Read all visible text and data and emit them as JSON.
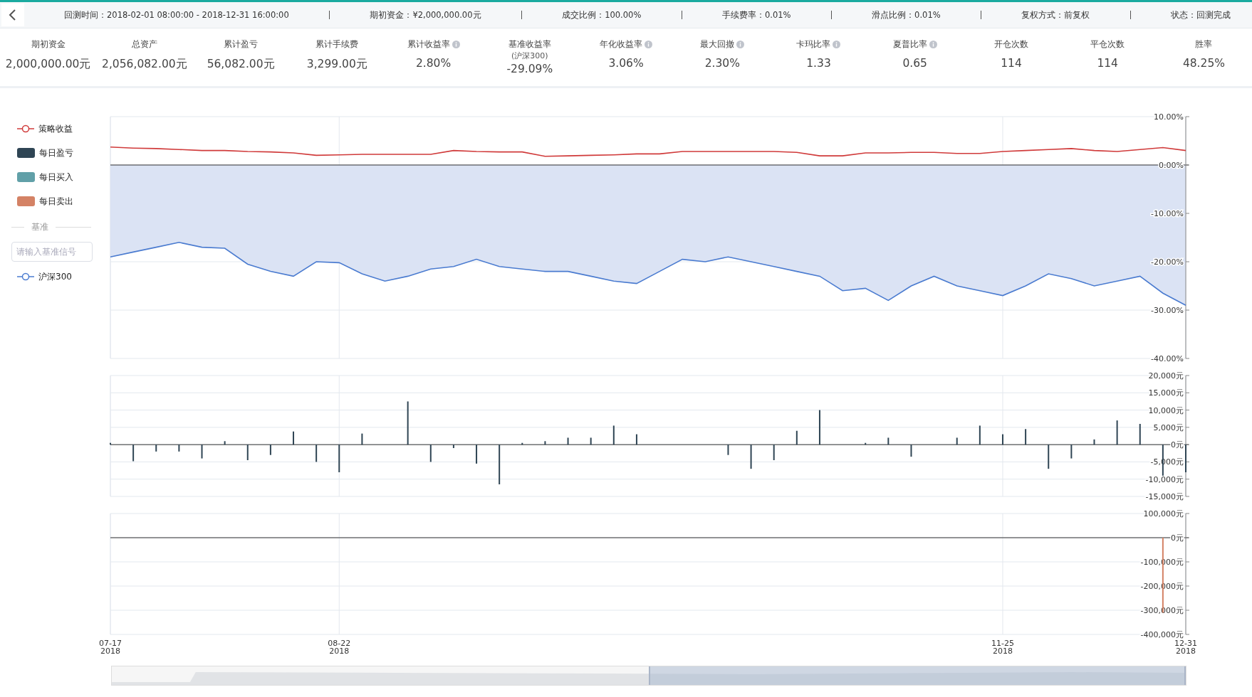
{
  "header": {
    "items": [
      {
        "label": "回测时间：2018-02-01 08:00:00 - 2018-12-31 16:00:00"
      },
      {
        "label": "期初资金：¥2,000,000.00元"
      },
      {
        "label": "成交比例：100.00%"
      },
      {
        "label": "手续费率：0.01%"
      },
      {
        "label": "滑点比例：0.01%"
      },
      {
        "label": "复权方式：前复权"
      },
      {
        "label": "状态：回测完成"
      }
    ]
  },
  "stats": [
    {
      "label": "期初资金",
      "value": "2,000,000.00元",
      "info": false
    },
    {
      "label": "总资产",
      "value": "2,056,082.00元",
      "info": false
    },
    {
      "label": "累计盈亏",
      "value": "56,082.00元",
      "info": false
    },
    {
      "label": "累计手续费",
      "value": "3,299.00元",
      "info": false
    },
    {
      "label": "累计收益率",
      "value": "2.80%",
      "info": true
    },
    {
      "label": "基准收益率",
      "sub": "(沪深300)",
      "value": "-29.09%",
      "info": false
    },
    {
      "label": "年化收益率",
      "value": "3.06%",
      "info": true
    },
    {
      "label": "最大回撤",
      "value": "2.30%",
      "info": true
    },
    {
      "label": "卡玛比率",
      "value": "1.33",
      "info": true
    },
    {
      "label": "夏普比率",
      "value": "0.65",
      "info": true
    },
    {
      "label": "开仓次数",
      "value": "114",
      "info": false
    },
    {
      "label": "平仓次数",
      "value": "114",
      "info": false
    },
    {
      "label": "胜率",
      "value": "48.25%",
      "info": false
    }
  ],
  "legend": [
    {
      "kind": "line",
      "label": "策略收益",
      "color": "#d03a3a"
    },
    {
      "kind": "swatch",
      "label": "每日盈亏",
      "color": "#2f4554"
    },
    {
      "kind": "swatch",
      "label": "每日买入",
      "color": "#61a0a8"
    },
    {
      "kind": "swatch",
      "label": "每日卖出",
      "color": "#d48265"
    }
  ],
  "benchmark": {
    "title": "基准",
    "placeholder": "请输入基准信号",
    "items": [
      {
        "kind": "line",
        "label": "沪深300",
        "color": "#4a7bd0"
      }
    ]
  },
  "charts": [
    {
      "chart_data": {
        "type": "line",
        "grid": true,
        "ylim": [
          -40,
          10
        ],
        "yticks": [
          {
            "value": 10,
            "label": "10.00%"
          },
          {
            "value": 0,
            "label": "0.00%"
          },
          {
            "value": -10,
            "label": "-10.00%"
          },
          {
            "value": -20,
            "label": "-20.00%"
          },
          {
            "value": -30,
            "label": "-30.00%"
          },
          {
            "value": -40,
            "label": "-40.00%"
          }
        ],
        "series": [
          {
            "color": "#d03a3a",
            "values": [
              3.7,
              3.5,
              3.4,
              3.2,
              3.0,
              3.0,
              2.8,
              2.7,
              2.5,
              2.0,
              2.1,
              2.2,
              2.2,
              2.2,
              2.2,
              3.0,
              2.8,
              2.7,
              2.7,
              1.8,
              1.9,
              2.0,
              2.1,
              2.3,
              2.3,
              2.8,
              2.8,
              2.8,
              2.8,
              2.8,
              2.6,
              1.9,
              1.9,
              2.5,
              2.5,
              2.6,
              2.6,
              2.4,
              2.4,
              2.8,
              3.0,
              3.2,
              3.4,
              3.0,
              2.8,
              3.2,
              3.6,
              3.0
            ]
          },
          {
            "color": "#4a7bd0",
            "values": [
              -19,
              -18,
              -17,
              -16,
              -17,
              -17.2,
              -20.5,
              -22,
              -23,
              -20,
              -20.2,
              -22.5,
              -24,
              -23,
              -21.5,
              -21,
              -19.5,
              -21,
              -21.5,
              -22,
              -22,
              -23,
              -24,
              -24.5,
              -22,
              -19.5,
              -20,
              -19,
              -20,
              -21,
              -22,
              -23,
              -26,
              -25.5,
              -28,
              -25,
              -23,
              -25,
              -26,
              -27,
              -25,
              -22.5,
              -23.5,
              -25,
              -24,
              -23,
              -26.5,
              -29
            ]
          }
        ]
      }
    },
    {
      "chart_data": {
        "type": "bar",
        "grid": true,
        "ylim": [
          -15000,
          20000
        ],
        "yticks": [
          {
            "value": 20000,
            "label": "20,000元"
          },
          {
            "value": 15000,
            "label": "15,000元"
          },
          {
            "value": 10000,
            "label": "10,000元"
          },
          {
            "value": 5000,
            "label": "5,000元"
          },
          {
            "value": 0,
            "label": "0元"
          },
          {
            "value": -5000,
            "label": "-5,000元"
          },
          {
            "value": -10000,
            "label": "-10,000元"
          },
          {
            "value": -15000,
            "label": "-15,000元"
          }
        ],
        "series": [
          {
            "color": "#2f4554",
            "values": [
              500,
              -4800,
              -2000,
              -2000,
              -4000,
              1000,
              -4500,
              -3000,
              3800,
              -5000,
              -8000,
              3200,
              0,
              12500,
              -5000,
              -1000,
              -5500,
              -11500,
              500,
              1000,
              2000,
              2000,
              5500,
              3000,
              0,
              0,
              0,
              -3000,
              -7000,
              -4500,
              4000,
              10000,
              0,
              500,
              2000,
              -3500,
              0,
              2000,
              5500,
              3000,
              4500,
              -7000,
              -4000,
              1500,
              7000,
              6000,
              -9000,
              -8000
            ]
          }
        ]
      }
    },
    {
      "year_labels": [
        "2018",
        "2018",
        "2018",
        "2018"
      ],
      "chart_data": {
        "type": "bar",
        "grid": true,
        "ylim": [
          -400000,
          100000
        ],
        "categories": [
          "07-17",
          null,
          null,
          null,
          null,
          null,
          null,
          null,
          null,
          null,
          "08-22",
          null,
          null,
          null,
          null,
          null,
          null,
          null,
          null,
          null,
          null,
          null,
          null,
          null,
          null,
          null,
          null,
          null,
          null,
          null,
          null,
          null,
          null,
          null,
          null,
          null,
          null,
          null,
          null,
          "11-25",
          null,
          null,
          null,
          null,
          null,
          null,
          null,
          "12-31"
        ],
        "yticks": [
          {
            "value": 100000,
            "label": "100,000元"
          },
          {
            "value": 0,
            "label": "0元"
          },
          {
            "value": -100000,
            "label": "-100,000元"
          },
          {
            "value": -200000,
            "label": "-200,000元"
          },
          {
            "value": -300000,
            "label": "-300,000元"
          },
          {
            "value": -400000,
            "label": "-400,000元"
          }
        ],
        "series": [
          {
            "color": "#d48265",
            "values": [
              null,
              null,
              null,
              null,
              null,
              null,
              null,
              null,
              null,
              null,
              null,
              null,
              null,
              null,
              null,
              null,
              null,
              null,
              null,
              null,
              null,
              null,
              null,
              null,
              null,
              null,
              null,
              null,
              null,
              null,
              null,
              null,
              null,
              null,
              null,
              null,
              null,
              null,
              null,
              null,
              null,
              null,
              null,
              null,
              null,
              null,
              -310000,
              null
            ]
          }
        ]
      }
    }
  ],
  "overview": {
    "level": 0.5
  }
}
